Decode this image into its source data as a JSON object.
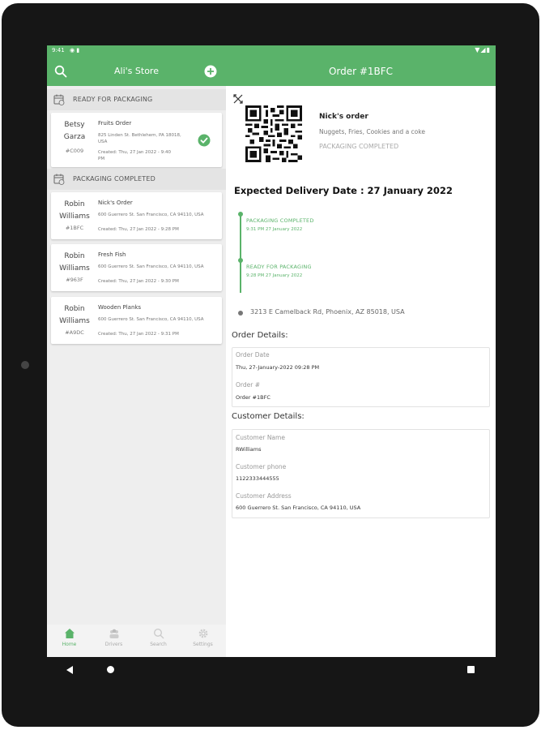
{
  "statusbar": {
    "time": "9:41"
  },
  "left_header": {
    "title": "Ali's Store"
  },
  "right_header": {
    "title": "Order #1BFC"
  },
  "sections": [
    {
      "label": "READY FOR PACKAGING"
    },
    {
      "label": "PACKAGING COMPLETED"
    }
  ],
  "orders": [
    {
      "first": "Betsy",
      "last": "Garza",
      "id": "#C009",
      "title": "Fruits Order",
      "address": "825 Linden St. Bethlehem, PA 18018, USA",
      "created": "Created: Thu, 27 Jan 2022 - 9:40 PM"
    },
    {
      "first": "Robin",
      "last": "Williams",
      "id": "#1BFC",
      "title": "Nick's Order",
      "address": "600 Guerrero St. San Francisco, CA 94110, USA",
      "created": "Created: Thu, 27 Jan 2022 - 9:28 PM"
    },
    {
      "first": "Robin",
      "last": "Williams",
      "id": "#963F",
      "title": "Fresh Fish",
      "address": "600 Guerrero St. San Francisco, CA 94110, USA",
      "created": "Created: Thu, 27 Jan 2022 - 9:30 PM"
    },
    {
      "first": "Robin",
      "last": "Williams",
      "id": "#A9DC",
      "title": "Wooden Planks",
      "address": "600 Guerrero St. San Francisco, CA 94110, USA",
      "created": "Created: Thu, 27 Jan 2022 - 9:31 PM"
    }
  ],
  "bottom_nav": [
    {
      "label": "Home"
    },
    {
      "label": "Drivers"
    },
    {
      "label": "Search"
    },
    {
      "label": "Settings"
    }
  ],
  "detail": {
    "order_name": "Nick's order",
    "items": "Nuggets, Fries, Cookies and a coke",
    "status": "PACKAGING COMPLETED",
    "expected_delivery": "Expected Delivery Date : 27 January 2022",
    "timeline": [
      {
        "title": "PACKAGING COMPLETED",
        "time": "9:31 PM 27 January 2022"
      },
      {
        "title": "READY FOR PACKAGING",
        "time": "9:28 PM 27 January 2022"
      }
    ],
    "destination": "3213 E Camelback Rd, Phoenix, AZ 85018, USA",
    "order_details_title": "Order Details:",
    "order_date_label": "Order Date",
    "order_date_value": "Thu, 27-January-2022 09:28 PM",
    "order_num_label": "Order #",
    "order_num_value": "Order #1BFC",
    "customer_details_title": "Customer Details:",
    "customer_name_label": "Customer Name",
    "customer_name_value": "RWilliams",
    "customer_phone_label": "Customer phone",
    "customer_phone_value": "1122333444555",
    "customer_address_label": "Customer Address",
    "customer_address_value": "600 Guerrero St. San Francisco, CA 94110, USA"
  },
  "colors": {
    "accent": "#5ab36a",
    "bezel": "#161616",
    "list_bg": "#eeeeee"
  },
  "icons": [
    "search-icon",
    "add-icon",
    "calendar-icon",
    "check-circle-icon",
    "collapse-icon",
    "qr-code",
    "home-icon",
    "drivers-icon",
    "search-nav-icon",
    "gear-icon"
  ]
}
